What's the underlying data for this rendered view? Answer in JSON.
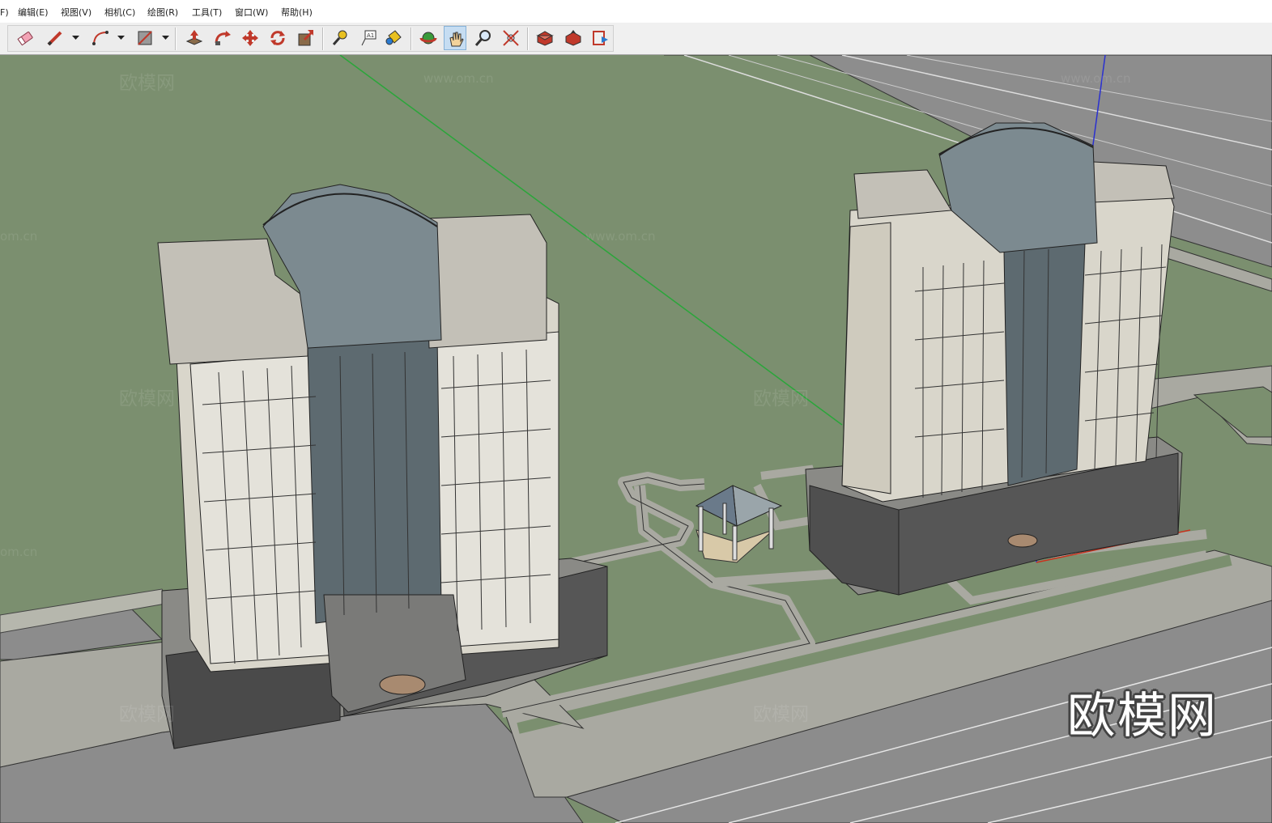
{
  "menu": {
    "file_partial": "F)",
    "edit": "编辑(E)",
    "view": "视图(V)",
    "camera": "相机(C)",
    "draw": "绘图(R)",
    "tools": "工具(T)",
    "window": "窗口(W)",
    "help": "帮助(H)"
  },
  "toolbar": {
    "tools": [
      "eraser",
      "pencil",
      "arc",
      "rectangle",
      "push-pull",
      "follow-me",
      "move",
      "rotate",
      "scale",
      "tape-measure",
      "text",
      "paint-bucket",
      "orbit",
      "pan",
      "zoom",
      "zoom-extents",
      "3d-warehouse",
      "share-model",
      "send-to-layout"
    ],
    "active_tool": "pan"
  },
  "watermarks": {
    "cn": "欧模网",
    "url": "www.om.cn",
    "url_cropped": "om.cn"
  },
  "brand_logo": "欧模网",
  "colors": {
    "ground": "#7b8f6f",
    "road": "#8c8c8c",
    "sidewalk": "#a9a9a1",
    "axis_green": "#2aa63a",
    "axis_blue": "#2a30d0",
    "axis_red": "#c8321e"
  }
}
